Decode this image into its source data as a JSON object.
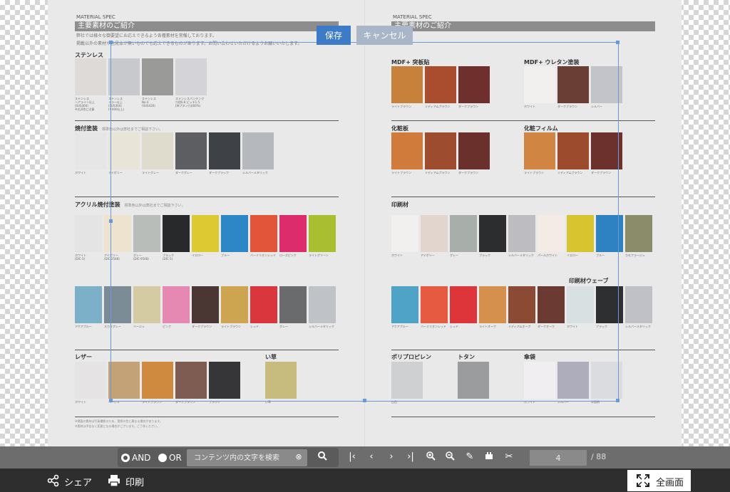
{
  "viewer": {
    "save_label": "保存",
    "cancel_label": "キャンセル"
  },
  "document": {
    "left_page": {
      "header_small": "MATERIAL SPEC",
      "header_title": "主要素材のご紹介",
      "intro": [
        "弊社では様々な御要望にお応えできるよう各種素材を常備しております。",
        "掲載以外の素材や色見本が無いものでも応えできるものがあります。お問い合わせいただけるようお願いいたします。"
      ],
      "sections": [
        {
          "title": "ステンレス",
          "note": "",
          "swatches": [
            {
              "color": "#dedad8",
              "caption": "ステンレス\nヘアライン仕上\n(SUS304)\n※光沢性に注意"
            },
            {
              "color": "#c7c9cc",
              "caption": "ステンレス\nミラー仕上\n(SUS304)\n(#400仕上)"
            },
            {
              "color": "#9a9a98",
              "caption": "ステンレス\nNo.4\n(SUS430)"
            },
            {
              "color": "#d4d4d8",
              "caption": "ステンレスパンチング\n穴径0.8 ピッチ1.5\n(Wプタン穴)(60%)"
            }
          ]
        },
        {
          "title": "焼付塗装",
          "note": "標準色以外は弊社までご相談下さい。",
          "swatches": [
            {
              "color": "#e6e6e6",
              "caption": "ホワイト"
            },
            {
              "color": "#e8e4d8",
              "caption": "アイボリー"
            },
            {
              "color": "#e0dccd",
              "caption": "ライトグレー"
            },
            {
              "color": "#5c5e62",
              "caption": "ダークグレー"
            },
            {
              "color": "#3e4246",
              "caption": "ダークブラック"
            },
            {
              "color": "#b5b9bd",
              "caption": "シルバーメタリック"
            }
          ]
        },
        {
          "title": "アクリル焼付塗装",
          "note": "標準色以外は弊社までご相談下さい。",
          "swatches": [
            {
              "color": "#e4e4e4",
              "caption": "ホワイト\n(DIC-3)"
            },
            {
              "color": "#ede3cf",
              "caption": "アイボリー\n(DIC-2548)"
            },
            {
              "color": "#b9bdb9",
              "caption": "グレー\n(DIC-9548)"
            },
            {
              "color": "#27292b",
              "caption": "ブラック\n(DIC-1)"
            },
            {
              "color": "#ddc932",
              "caption": "イエロー"
            },
            {
              "color": "#2d86c6",
              "caption": "ブルー"
            },
            {
              "color": "#e2553b",
              "caption": "バーミリオンレッド"
            },
            {
              "color": "#dd2c6c",
              "caption": "ローズピンク"
            },
            {
              "color": "#a9bf2f",
              "caption": "ライトグリーン"
            },
            {
              "color": "#7cb0c8",
              "caption": "アクアブルー"
            },
            {
              "color": "#7b8c96",
              "caption": "スカイグレー"
            },
            {
              "color": "#d5cba3",
              "caption": "ベージュ"
            },
            {
              "color": "#e588b2",
              "caption": "ピンク"
            },
            {
              "color": "#4a3633",
              "caption": "ダークブラウン"
            },
            {
              "color": "#cda44f",
              "caption": "ライトブラウン"
            },
            {
              "color": "#d9363e",
              "caption": "レッド"
            },
            {
              "color": "#6a6b6d",
              "caption": "グレー"
            },
            {
              "color": "#bfc3c7",
              "caption": "シルバーメタリック"
            }
          ]
        },
        {
          "title": "レザー",
          "note": "",
          "swatches": [
            {
              "color": "#e6e3e5",
              "caption": "ホワイト"
            },
            {
              "color": "#c4a277",
              "caption": "ベージュ"
            },
            {
              "color": "#cf8a3f",
              "caption": "ライトブラウン"
            },
            {
              "color": "#7f5c52",
              "caption": "ダークブラウン"
            },
            {
              "color": "#363638",
              "caption": "ブラック"
            }
          ]
        },
        {
          "title": "い草",
          "note": "",
          "swatches": [
            {
              "color": "#c7bb7d",
              "caption": "い草"
            }
          ]
        }
      ],
      "footer": [
        "※掲載の素材は写真撮影のため、実際の色と異なる場合があります。",
        "※素材は予告なく変更になる場合がございます。ご了承ください。"
      ]
    },
    "right_page": {
      "header_small": "MATERIAL SPEC",
      "header_title": "主要素材のご紹介",
      "sections": [
        {
          "title": "MDF+ 突板貼",
          "note": "",
          "swatches": [
            {
              "color": "#c7813a",
              "caption": "ライトブラウン"
            },
            {
              "color": "#a94d2e",
              "caption": "ミディアムブラウン"
            },
            {
              "color": "#6e2f2d",
              "caption": "ダークブラウン"
            }
          ]
        },
        {
          "title": "MDF+ ウレタン塗装",
          "note": "",
          "swatches": [
            {
              "color": "#f2f0ef",
              "caption": "ホワイト"
            },
            {
              "color": "#6b3e35",
              "caption": "ダークブラウン"
            },
            {
              "color": "#c3c3ca",
              "caption": "シルバー"
            }
          ]
        },
        {
          "title": "化粧板",
          "note": "",
          "swatches": [
            {
              "color": "#d07a3c",
              "caption": "ライトブラウン"
            },
            {
              "color": "#9e4c2f",
              "caption": "ミディアムブラウン"
            },
            {
              "color": "#6a302c",
              "caption": "ダークブラウン"
            }
          ]
        },
        {
          "title": "化粧フィルム",
          "note": "",
          "swatches": [
            {
              "color": "#d08543",
              "caption": "ライトブラウン"
            },
            {
              "color": "#9c4b2c",
              "caption": "ミディアムブラウン"
            },
            {
              "color": "#6c312c",
              "caption": "ダークブラウン"
            }
          ]
        },
        {
          "title": "印刷材",
          "note": "",
          "swatches": [
            {
              "color": "#f2f0ef",
              "caption": "ホワイト"
            },
            {
              "color": "#e2d5cd",
              "caption": "アイボリー"
            },
            {
              "color": "#a8aea9",
              "caption": "グレー"
            },
            {
              "color": "#2c2d2f",
              "caption": "ブラック"
            },
            {
              "color": "#bdbcc0",
              "caption": "シルバーメタリック"
            },
            {
              "color": "#f4ebe7",
              "caption": "パールホワイト"
            },
            {
              "color": "#d8c42e",
              "caption": "イエロー"
            },
            {
              "color": "#2f82c2",
              "caption": "ブルー"
            },
            {
              "color": "#8a8c6a",
              "caption": "カモフラージュ"
            },
            {
              "color": "#4fa3c6",
              "caption": "アクアブルー"
            },
            {
              "color": "#e55a41",
              "caption": "バーミリオンレッド"
            },
            {
              "color": "#dd3539",
              "caption": "レッド"
            },
            {
              "color": "#d6904e",
              "caption": "ライトオーク"
            },
            {
              "color": "#8b4a34",
              "caption": "ミディアムオーク"
            },
            {
              "color": "#6b3b33",
              "caption": "ダークオーク"
            },
            {
              "color": "#d8e0e2",
              "caption": "ホワイト"
            },
            {
              "color": "#2e2f31",
              "caption": "ブラック"
            },
            {
              "color": "#c0c1c6",
              "caption": "シルバーメタリック"
            }
          ]
        },
        {
          "title": "印刷材ウェーブ",
          "note": "",
          "swatches": []
        },
        {
          "title": "ポリプロピレン",
          "note": "",
          "swatches": [
            {
              "color": "#cfd0d2",
              "caption": "白色"
            }
          ]
        },
        {
          "title": "トタン",
          "note": "",
          "swatches": [
            {
              "color": "#9b9c9e",
              "caption": ""
            }
          ]
        },
        {
          "title": "傘袋",
          "note": "",
          "swatches": [
            {
              "color": "#f0eef1",
              "caption": "ホワイト"
            },
            {
              "color": "#aeadbb",
              "caption": "シルバー"
            },
            {
              "color": "#dadce0",
              "caption": "半透明"
            }
          ]
        }
      ]
    }
  },
  "toolbar": {
    "and_label": "AND",
    "or_label": "OR",
    "search_placeholder": "コンテンツ内の文字を検索",
    "current_page": "4",
    "total_pages": "/ 88",
    "icons": [
      "search-icon",
      "first-page-icon",
      "prev-page-icon",
      "next-page-icon",
      "last-page-icon",
      "zoom-in-icon",
      "zoom-out-icon",
      "pen-icon",
      "marker-icon",
      "scissors-icon"
    ]
  },
  "bottombar": {
    "share_label": "シェア",
    "print_label": "印刷",
    "fullscreen_label": "全画面"
  }
}
